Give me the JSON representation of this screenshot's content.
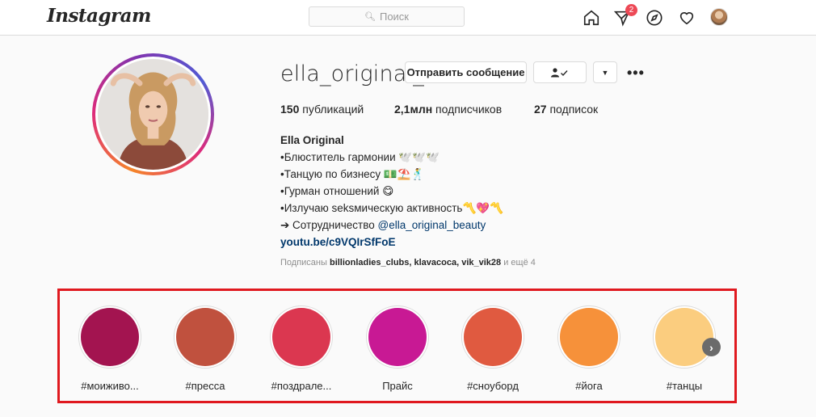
{
  "header": {
    "logo_text": "Instagram",
    "search": {
      "icon": "search-icon",
      "placeholder": "Поиск"
    },
    "nav": [
      {
        "name": "home-icon"
      },
      {
        "name": "direct-icon",
        "badge": "2"
      },
      {
        "name": "explore-icon"
      },
      {
        "name": "activity-heart-icon"
      },
      {
        "name": "profile-avatar-icon"
      }
    ]
  },
  "profile": {
    "username": "ella_original_",
    "message_button": "Отправить сообщение",
    "follow_icon": "person-check-icon",
    "dropdown_icon": "caret-down-icon",
    "more_label": "•••",
    "stats": {
      "posts_count": "150",
      "posts_label": " публикаций",
      "followers_count": "2,1млн",
      "followers_label": " подписчиков",
      "following_count": "27",
      "following_label": " подписок"
    },
    "bio": {
      "name": "Ella Original",
      "lines": [
        "•Блюститель гармонии 🕊️🕊️🕊️",
        "•Танцую по бизнесу 💵⛱️🕺",
        "•Гурман отношений 😋",
        "•Излучаю seksмическую активность〽️💖〽️"
      ],
      "collab_prefix": "➔ Сотрудничество ",
      "collab_mention": "@ella_original_beauty",
      "link": "youtu.be/c9VQIrSfFoE"
    },
    "followed_by": {
      "prefix": "Подписаны ",
      "users": "billionladies_clubs, klavacoca, vik_vik28",
      "suffix": " и ещё 4"
    }
  },
  "highlights": [
    {
      "label": "#моиживо...",
      "color": "#a31450"
    },
    {
      "label": "#пресса",
      "color": "#c0513e"
    },
    {
      "label": "#поздрале...",
      "color": "#db3750"
    },
    {
      "label": "Прайс",
      "color": "#c81994"
    },
    {
      "label": "#сноуборд",
      "color": "#e05a40"
    },
    {
      "label": "#йога",
      "color": "#f6913a"
    },
    {
      "label": "#танцы",
      "color": "#fbcd7f"
    }
  ],
  "highlight_next_icon": "chevron-right-icon",
  "colors": {
    "highlight_frame": "#e0191f",
    "link": "#00376b",
    "badge": "#ed4956"
  }
}
